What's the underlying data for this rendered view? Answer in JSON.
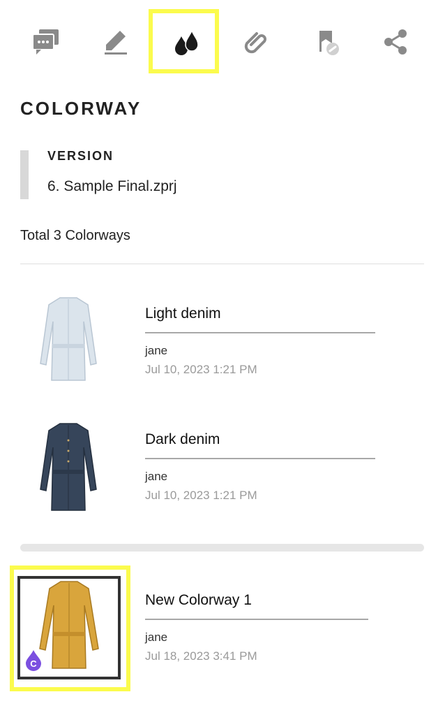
{
  "toolbar": {
    "buttons": [
      {
        "name": "comments",
        "icon": "comment-icon"
      },
      {
        "name": "edit",
        "icon": "pencil-icon"
      },
      {
        "name": "colorway",
        "icon": "drops-icon",
        "selected": true
      },
      {
        "name": "attachments",
        "icon": "paperclip-icon"
      },
      {
        "name": "pin-link",
        "icon": "flag-link-icon"
      },
      {
        "name": "share",
        "icon": "share-icon"
      }
    ]
  },
  "section": {
    "title": "COLORWAY",
    "version_label": "VERSION",
    "version_file": "6. Sample Final.zprj",
    "total": "Total 3 Colorways"
  },
  "colorways": [
    {
      "name": "Light denim",
      "user": "jane",
      "date": "Jul 10, 2023 1:21 PM",
      "color": "#dbe4ec"
    },
    {
      "name": "Dark denim",
      "user": "jane",
      "date": "Jul 10, 2023 1:21 PM",
      "color": "#36455a"
    },
    {
      "name": "New Colorway 1",
      "user": "jane",
      "date": "Jul 18, 2023 3:41 PM",
      "color": "#d9a53c",
      "badge": "C"
    }
  ],
  "colors": {
    "highlight": "#fbfb4d",
    "icon": "#8a8a8a",
    "icon_active": "#1a1a1a",
    "badge": "#7b4fe0"
  }
}
